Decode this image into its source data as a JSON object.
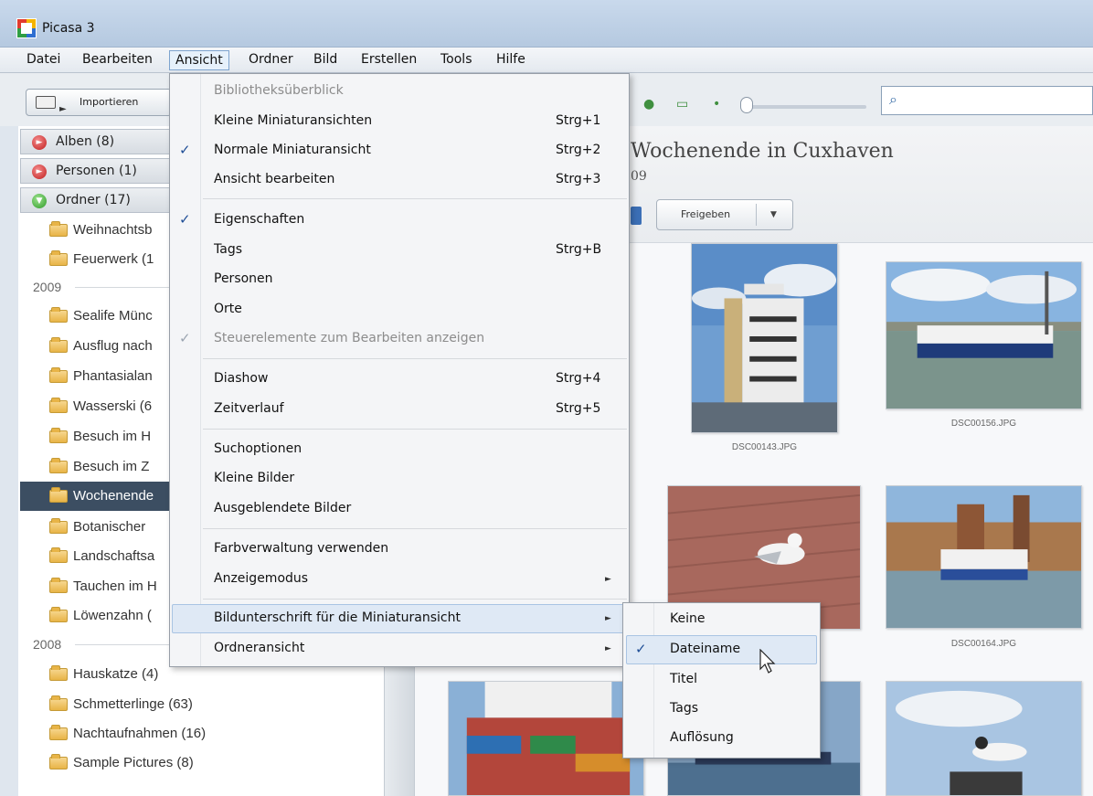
{
  "window": {
    "title": "Picasa 3"
  },
  "menubar": [
    {
      "label": "Datei"
    },
    {
      "label": "Bearbeiten"
    },
    {
      "label": "Ansicht"
    },
    {
      "label": "Ordner"
    },
    {
      "label": "Bild"
    },
    {
      "label": "Erstellen"
    },
    {
      "label": "Tools"
    },
    {
      "label": "Hilfe"
    }
  ],
  "toolbar": {
    "import_label": "Importieren",
    "search_value": "",
    "search_icon": "magnifier-icon"
  },
  "sidebar": {
    "sections": [
      {
        "label": "Alben (8)",
        "state": "collapsed"
      },
      {
        "label": "Personen (1)",
        "state": "collapsed"
      },
      {
        "label": "Ordner (17)",
        "state": "expanded"
      }
    ],
    "items": [
      {
        "label": "Weihnachtsb"
      },
      {
        "label": "Feuerwerk (1"
      },
      {
        "label": "2009"
      },
      {
        "label": "Sealife Münc"
      },
      {
        "label": "Ausflug nach"
      },
      {
        "label": "Phantasialan"
      },
      {
        "label": "Wasserski (6"
      },
      {
        "label": "Besuch im H"
      },
      {
        "label": "Besuch im Z"
      },
      {
        "label": "Wochenende"
      },
      {
        "label": "Botanischer"
      },
      {
        "label": "Landschaftsa"
      },
      {
        "label": "Tauchen im H"
      },
      {
        "label": "Löwenzahn ("
      },
      {
        "label": "2008"
      },
      {
        "label": "Hauskatze (4)"
      },
      {
        "label": "Schmetterlinge (63)"
      },
      {
        "label": "Nachtaufnahmen (16)"
      },
      {
        "label": "Sample Pictures (8)"
      }
    ]
  },
  "album": {
    "title": "Wochenende in Cuxhaven",
    "date": "09",
    "share_label": "Freigeben"
  },
  "photos": [
    {
      "caption": "DSC00143.JPG"
    },
    {
      "caption": "DSC00156.JPG"
    },
    {
      "caption": "DSC00164.JPG"
    }
  ],
  "view_menu": {
    "items": [
      {
        "label": "Bibliotheksüberblick",
        "shortcut": ""
      },
      {
        "label": "Kleine Miniaturansichten",
        "shortcut": "Strg+1"
      },
      {
        "label": "Normale Miniaturansicht",
        "shortcut": "Strg+2"
      },
      {
        "label": "Ansicht bearbeiten",
        "shortcut": "Strg+3"
      },
      {
        "label": "Eigenschaften",
        "shortcut": ""
      },
      {
        "label": "Tags",
        "shortcut": "Strg+B"
      },
      {
        "label": "Personen",
        "shortcut": ""
      },
      {
        "label": "Orte",
        "shortcut": ""
      },
      {
        "label": "Steuerelemente zum Bearbeiten anzeigen",
        "shortcut": ""
      },
      {
        "label": "Diashow",
        "shortcut": "Strg+4"
      },
      {
        "label": "Zeitverlauf",
        "shortcut": "Strg+5"
      },
      {
        "label": "Suchoptionen",
        "shortcut": ""
      },
      {
        "label": "Kleine Bilder",
        "shortcut": ""
      },
      {
        "label": "Ausgeblendete Bilder",
        "shortcut": ""
      },
      {
        "label": "Farbverwaltung verwenden",
        "shortcut": ""
      },
      {
        "label": "Anzeigemodus",
        "shortcut": ""
      },
      {
        "label": "Bildunterschrift für die Miniaturansicht",
        "shortcut": ""
      },
      {
        "label": "Ordneransicht",
        "shortcut": ""
      }
    ]
  },
  "caption_submenu": {
    "items": [
      {
        "label": "Keine"
      },
      {
        "label": "Dateiname"
      },
      {
        "label": "Titel"
      },
      {
        "label": "Tags"
      },
      {
        "label": "Auflösung"
      }
    ]
  },
  "glyphs": {
    "check": "✓",
    "submenu_arrow": "►"
  }
}
